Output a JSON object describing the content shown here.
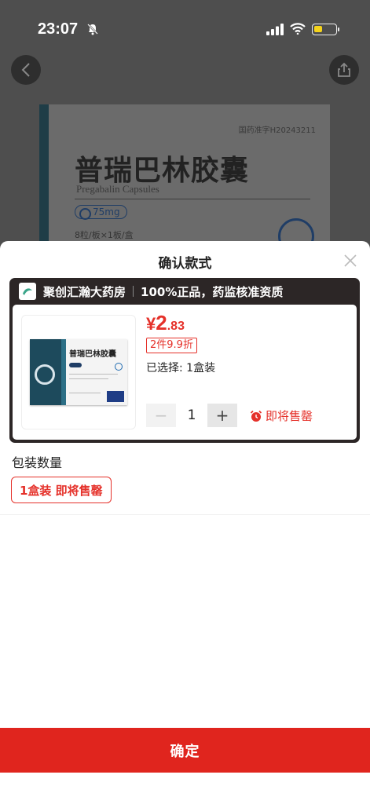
{
  "status_bar": {
    "time": "23:07",
    "battery_level": 0.3,
    "battery_color": "#f5d31b"
  },
  "background": {
    "product_name": "普瑞巴林胶囊",
    "english_name": "Pregabalin Capsules",
    "approval": "国药准字H20243211",
    "dose": "75mg",
    "spec": "8粒/板×1板/盒"
  },
  "sheet": {
    "title": "确认款式",
    "store": {
      "name": "聚创汇瀚大药房",
      "slogan": "100%正品，药监核准资质"
    },
    "product": {
      "thumb_name": "普瑞巴林胶囊",
      "price_currency": "¥",
      "price_int": "2",
      "price_dec": ".83",
      "promo": "2件9.9折",
      "selected": "已选择: 1盒装",
      "quantity": "1",
      "minus": "−",
      "plus": "+",
      "soon_label": "即将售罄"
    },
    "section_label": "包装数量",
    "options": [
      {
        "label": "1盒装 即将售罄",
        "selected": true
      }
    ],
    "confirm_label": "确定"
  },
  "colors": {
    "accent": "#e5312a",
    "store_header": "#2c2626",
    "confirm": "#e0251e"
  },
  "icons": [
    "back-icon",
    "share-icon",
    "close-icon",
    "alarm-icon",
    "bell-slash-icon",
    "store-logo-icon"
  ]
}
